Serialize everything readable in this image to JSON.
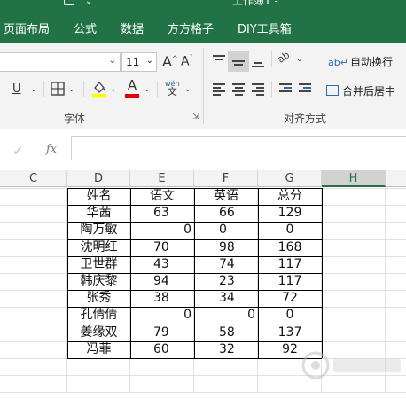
{
  "title_bar": {
    "title": "工作簿1 -"
  },
  "tabs": [
    {
      "label": "页面布局"
    },
    {
      "label": "公式"
    },
    {
      "label": "数据"
    },
    {
      "label": "方方格子"
    },
    {
      "label": "DIY工具箱"
    }
  ],
  "ribbon": {
    "font_name": "",
    "font_size": "11",
    "grow_font": "A",
    "shrink_font": "A",
    "underline": "U",
    "font_color_glyph": "A",
    "phonetic_glyph": "wén",
    "phonetic_sub": "文",
    "font_group_label": "字体",
    "align_group_label": "对齐方式",
    "wrap_text": "自动换行",
    "merge_center": "合并后居中",
    "orientation_glyph": "ab",
    "colors": {
      "fill_color": "#ffff00",
      "font_color": "#e00000",
      "accent": "#217346"
    }
  },
  "formula_bar": {
    "cancel_glyph": "✕",
    "confirm_glyph": "✓",
    "fx": "fx",
    "value": ""
  },
  "columns": [
    {
      "name": "C",
      "selected": false
    },
    {
      "name": "D",
      "selected": false
    },
    {
      "name": "E",
      "selected": false
    },
    {
      "name": "F",
      "selected": false
    },
    {
      "name": "G",
      "selected": false
    },
    {
      "name": "H",
      "selected": true
    }
  ],
  "table": {
    "headers": [
      "姓名",
      "语文",
      "英语",
      "总分"
    ],
    "rows": [
      [
        "华茜",
        "63",
        "66",
        "129"
      ],
      [
        "陶万敏",
        "0",
        "0",
        "0"
      ],
      [
        "沈明红",
        "70",
        "98",
        "168"
      ],
      [
        "卫世群",
        "43",
        "74",
        "117"
      ],
      [
        "韩庆黎",
        "94",
        "23",
        "117"
      ],
      [
        "张秀",
        "38",
        "34",
        "72"
      ],
      [
        "孔倩倩",
        "0",
        "0",
        "0"
      ],
      [
        "姜缘双",
        "79",
        "58",
        "137"
      ],
      [
        "冯菲",
        "60",
        "32",
        "92"
      ]
    ]
  }
}
